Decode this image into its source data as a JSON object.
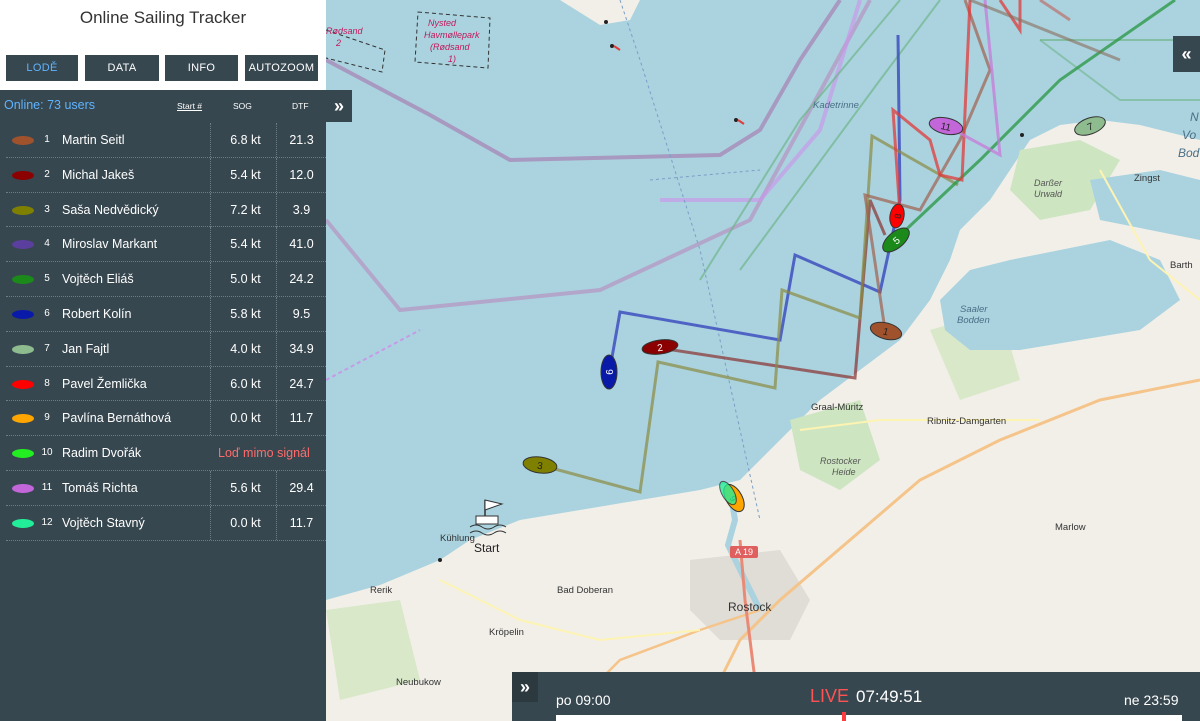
{
  "app": {
    "title": "Online Sailing Tracker"
  },
  "menu": {
    "lode": "LODĚ",
    "data": "DATA",
    "info": "INFO",
    "autozoom": "AUTOZOOM"
  },
  "list_header": {
    "online": "Online: 73 users",
    "start": "Start #",
    "sog": "SOG",
    "dtf": "DTF",
    "collapse": "»"
  },
  "boats": [
    {
      "num": "1",
      "name": "Martin Seitl",
      "sog": "6.8 kt",
      "dtf": "21.3",
      "color": "#a0522d"
    },
    {
      "num": "2",
      "name": "Michal Jakeš",
      "sog": "5.4 kt",
      "dtf": "12.0",
      "color": "#8b0000"
    },
    {
      "num": "3",
      "name": "Saša Nedvědický",
      "sog": "7.2 kt",
      "dtf": "3.9",
      "color": "#808000"
    },
    {
      "num": "4",
      "name": "Miroslav Markant",
      "sog": "5.4 kt",
      "dtf": "41.0",
      "color": "#5b3f9e"
    },
    {
      "num": "5",
      "name": "Vojtěch Eliáš",
      "sog": "5.0 kt",
      "dtf": "24.2",
      "color": "#1b8a1b"
    },
    {
      "num": "6",
      "name": "Robert Kolín",
      "sog": "5.8 kt",
      "dtf": "9.5",
      "color": "#0a1aa8"
    },
    {
      "num": "7",
      "name": "Jan Fajtl",
      "sog": "4.0 kt",
      "dtf": "34.9",
      "color": "#8fbc8f"
    },
    {
      "num": "8",
      "name": "Pavel Žemlička",
      "sog": "6.0 kt",
      "dtf": "24.7",
      "color": "#ff0000"
    },
    {
      "num": "9",
      "name": "Pavlína Bernáthová",
      "sog": "0.0 kt",
      "dtf": "11.7",
      "color": "#ffa500"
    },
    {
      "num": "10",
      "name": "Radim Dvořák",
      "status": "Loď mimo signál",
      "color": "#22ee22"
    },
    {
      "num": "11",
      "name": "Tomáš Richta",
      "sog": "5.6 kt",
      "dtf": "29.4",
      "color": "#c266d9"
    },
    {
      "num": "12",
      "name": "Vojtěch Stavný",
      "sog": "0.0 kt",
      "dtf": "11.7",
      "color": "#22ee99"
    }
  ],
  "map_labels": {
    "kadetrinne": "Kadetrinne",
    "graal": "Graal-Müritz",
    "ribnitz": "Ribnitz-Damgarten",
    "rostocker": "Rostocker",
    "heide": "Heide",
    "rostock": "Rostock",
    "bad_doberan": "Bad Doberan",
    "rerik": "Rerik",
    "kropelin": "Kröpelin",
    "neubukow": "Neubukow",
    "kuhlung": "Kühlung",
    "start": "Start",
    "zingst": "Zingst",
    "darsser": "Darßer",
    "urwald": "Urwald",
    "saaler": "Saaler",
    "bodden": "Bodden",
    "barth": "Barth",
    "marlow": "Marlow",
    "a19": "A 19",
    "nystedt1": "Nysted",
    "nystedt2": "Havmøllepark",
    "nystedt3": "(Rødsand",
    "nystedt4": "1)",
    "rodsand1": "Rødsand",
    "rodsand2": "2",
    "bodden_right1": "N",
    "bodden_right2": "Vo",
    "bodden_right3": "Bod"
  },
  "timeline": {
    "start": "po 09:00",
    "live": "LIVE",
    "time": "07:49:51",
    "end": "ne 23:59",
    "position": 0.46,
    "toggle": "»"
  },
  "expand_right": "«"
}
